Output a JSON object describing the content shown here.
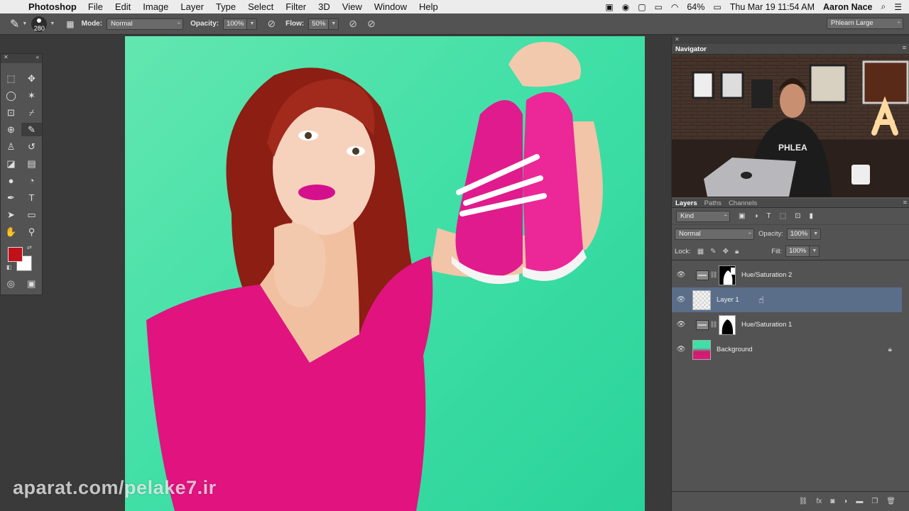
{
  "menubar": {
    "apple_icon": "apple-icon",
    "app_name": "Photoshop",
    "items": [
      "File",
      "Edit",
      "Image",
      "Layer",
      "Type",
      "Select",
      "Filter",
      "3D",
      "View",
      "Window",
      "Help"
    ],
    "battery": "64%",
    "datetime": "Thu Mar 19  11:54 AM",
    "user": "Aaron Nace"
  },
  "options": {
    "brush_size": "280",
    "mode_label": "Mode:",
    "mode_value": "Normal",
    "opacity_label": "Opacity:",
    "opacity_value": "100%",
    "flow_label": "Flow:",
    "flow_value": "50%",
    "workspace": "Phlearn Large"
  },
  "colors": {
    "foreground": "#c0101a",
    "background": "#ffffff",
    "canvas_bg": "#3fdfa6",
    "selected_layer": "#5a6e8a"
  },
  "navigator": {
    "title": "Navigator",
    "shirt_text": "PHLEA",
    "sign_letter": "A"
  },
  "layers": {
    "tabs": [
      "Layers",
      "Paths",
      "Channels"
    ],
    "filter_kind": "Kind",
    "blend_mode": "Normal",
    "opacity_label": "Opacity:",
    "opacity_value": "100%",
    "lock_label": "Lock:",
    "fill_label": "Fill:",
    "fill_value": "100%",
    "list": [
      {
        "name": "Hue/Saturation 2",
        "type": "adjustment"
      },
      {
        "name": "Layer 1",
        "type": "pixel",
        "selected": true
      },
      {
        "name": "Hue/Saturation 1",
        "type": "adjustment"
      },
      {
        "name": "Background",
        "type": "background",
        "locked": true
      }
    ]
  },
  "watermark": "aparat.com/pelake7.ir"
}
